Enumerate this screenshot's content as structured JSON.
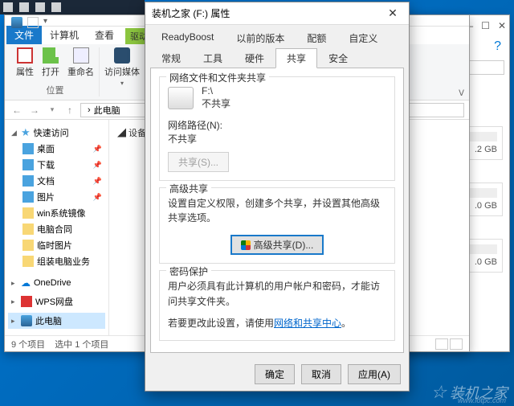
{
  "taskbar": {
    "items": [
      "start",
      "search",
      "task",
      "explorer"
    ]
  },
  "explorer": {
    "ribbon_badge": "驱动",
    "tabs": {
      "file": "文件",
      "computer": "计算机",
      "view": "查看"
    },
    "ribbon": {
      "properties": "属性",
      "open": "打开",
      "rename": "重命名",
      "access_media": "访问媒体",
      "group1": "位置",
      "collapse": "ᐯ"
    },
    "nav": {
      "back": "←",
      "forward": "→",
      "up": "↑"
    },
    "breadcrumb": {
      "root_icon": "▸",
      "label": "此电脑",
      "sep": "›"
    },
    "content_header": "◢ 设备",
    "tree": {
      "quick": "快速访问",
      "desktop": "桌面",
      "downloads": "下载",
      "documents": "文档",
      "pictures": "图片",
      "winimg": "win系统镜像",
      "pc_contract": "电脑合同",
      "temp_pics": "临时图片",
      "group_biz": "组装电脑业务",
      "onedrive": "OneDrive",
      "wps": "WPS网盘",
      "this_pc": "此电脑"
    },
    "status": {
      "count": "9 个项目",
      "selected": "选中 1 个项目"
    }
  },
  "bg": {
    "help": "?",
    "size1": ".2 GB",
    "size2": ".0 GB",
    "size3": ".0 GB"
  },
  "dialog": {
    "title": "装机之家 (F:) 属性",
    "tabs": {
      "readyboost": "ReadyBoost",
      "prev": "以前的版本",
      "quota": "配额",
      "custom": "自定义",
      "general": "常规",
      "tools": "工具",
      "hardware": "硬件",
      "sharing": "共享",
      "security": "安全"
    },
    "section_net": "网络文件和文件夹共享",
    "drive_path": "F:\\",
    "not_shared": "不共享",
    "net_path_label": "网络路径(N):",
    "net_path_value": "不共享",
    "share_btn": "共享(S)...",
    "section_adv": "高级共享",
    "adv_text": "设置自定义权限，创建多个共享，并设置其他高级共享选项。",
    "adv_btn": "高级共享(D)...",
    "section_pwd": "密码保护",
    "pwd_text1": "用户必须具有此计算机的用户帐户和密码，才能访问共享文件夹。",
    "pwd_text2_a": "若要更改此设置，请使用",
    "pwd_link": "网络和共享中心",
    "pwd_text2_b": "。",
    "ok": "确定",
    "cancel": "取消",
    "apply": "应用(A)"
  },
  "watermark": {
    "text": "装机之家",
    "sub": "www.lotpc.com"
  }
}
